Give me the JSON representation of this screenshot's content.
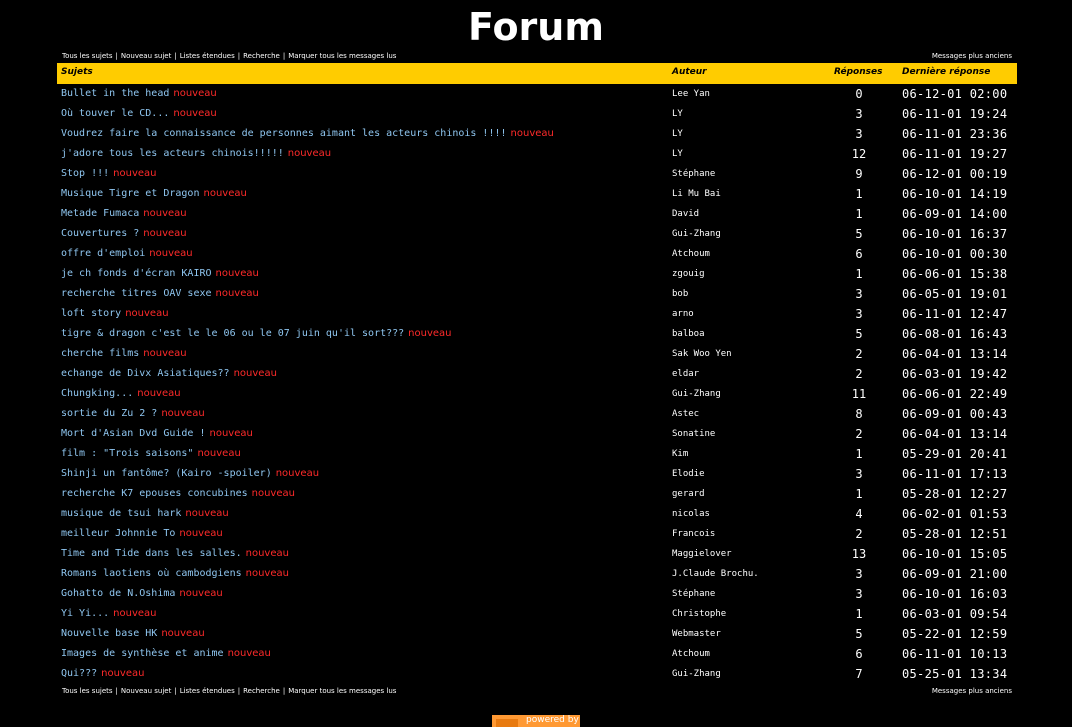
{
  "title": "Forum",
  "nav": {
    "links": [
      "Tous les sujets",
      "Nouveau sujet",
      "Listes étendues",
      "Recherche",
      "Marquer tous les messages lus"
    ],
    "older": "Messages plus anciens"
  },
  "columns": {
    "subject": "Sujets",
    "author": "Auteur",
    "replies": "Réponses",
    "last": "Dernière réponse"
  },
  "new_label": "nouveau",
  "topics": [
    {
      "subject": "Bullet in the head",
      "author": "Lee Yan",
      "replies": "0",
      "last": "06-12-01 02:00"
    },
    {
      "subject": "Où touver le CD...",
      "author": "LY",
      "replies": "3",
      "last": "06-11-01 19:24"
    },
    {
      "subject": "Voudrez faire la connaissance de personnes aimant les acteurs chinois !!!!",
      "author": "LY",
      "replies": "3",
      "last": "06-11-01 23:36"
    },
    {
      "subject": "j'adore tous les acteurs chinois!!!!!",
      "author": "LY",
      "replies": "12",
      "last": "06-11-01 19:27"
    },
    {
      "subject": "Stop !!!",
      "author": "Stéphane",
      "replies": "9",
      "last": "06-12-01 00:19"
    },
    {
      "subject": "Musique Tigre et Dragon",
      "author": "Li Mu Bai",
      "replies": "1",
      "last": "06-10-01 14:19"
    },
    {
      "subject": "Metade Fumaca",
      "author": "David",
      "replies": "1",
      "last": "06-09-01 14:00"
    },
    {
      "subject": "Couvertures ?",
      "author": "Gui-Zhang",
      "replies": "5",
      "last": "06-10-01 16:37"
    },
    {
      "subject": "offre d'emploi",
      "author": "Atchoum",
      "replies": "6",
      "last": "06-10-01 00:30"
    },
    {
      "subject": "je ch fonds d'écran KAIRO",
      "author": "zgouig",
      "replies": "1",
      "last": "06-06-01 15:38"
    },
    {
      "subject": "recherche titres OAV sexe",
      "author": "bob",
      "replies": "3",
      "last": "06-05-01 19:01"
    },
    {
      "subject": "loft story",
      "author": "arno",
      "replies": "3",
      "last": "06-11-01 12:47"
    },
    {
      "subject": "tigre & dragon c'est le le 06 ou le 07 juin qu'il sort???",
      "author": "balboa",
      "replies": "5",
      "last": "06-08-01 16:43"
    },
    {
      "subject": "cherche films",
      "author": "Sak Woo Yen",
      "replies": "2",
      "last": "06-04-01 13:14"
    },
    {
      "subject": "echange de Divx Asiatiques??",
      "author": "eldar",
      "replies": "2",
      "last": "06-03-01 19:42"
    },
    {
      "subject": "Chungking...",
      "author": "Gui-Zhang",
      "replies": "11",
      "last": "06-06-01 22:49"
    },
    {
      "subject": "sortie du Zu 2 ?",
      "author": "Astec",
      "replies": "8",
      "last": "06-09-01 00:43"
    },
    {
      "subject": "Mort d'Asian Dvd Guide !",
      "author": "Sonatine",
      "replies": "2",
      "last": "06-04-01 13:14"
    },
    {
      "subject": "film : \"Trois saisons\"",
      "author": "Kim",
      "replies": "1",
      "last": "05-29-01 20:41"
    },
    {
      "subject": "Shinji un fantôme? (Kairo -spoiler)",
      "author": "Elodie",
      "replies": "3",
      "last": "06-11-01 17:13"
    },
    {
      "subject": "recherche K7 epouses concubines",
      "author": "gerard",
      "replies": "1",
      "last": "05-28-01 12:27"
    },
    {
      "subject": "musique de tsui hark",
      "author": "nicolas",
      "replies": "4",
      "last": "06-02-01 01:53"
    },
    {
      "subject": "meilleur Johnnie To",
      "author": "Francois",
      "replies": "2",
      "last": "05-28-01 12:51"
    },
    {
      "subject": "Time and Tide dans les salles.",
      "author": "Maggielover",
      "replies": "13",
      "last": "06-10-01 15:05"
    },
    {
      "subject": "Romans laotiens où cambodgiens",
      "author": "J.Claude Brochu.",
      "replies": "3",
      "last": "06-09-01 21:00"
    },
    {
      "subject": "Gohatto de N.Oshima",
      "author": "Stéphane",
      "replies": "3",
      "last": "06-10-01 16:03"
    },
    {
      "subject": "Yi Yi...",
      "author": "Christophe",
      "replies": "1",
      "last": "06-03-01 09:54"
    },
    {
      "subject": "Nouvelle base HK",
      "author": "Webmaster",
      "replies": "5",
      "last": "05-22-01 12:59"
    },
    {
      "subject": "Images de synthèse et anime",
      "author": "Atchoum",
      "replies": "6",
      "last": "06-11-01 10:13"
    },
    {
      "subject": "Qui???",
      "author": "Gui-Zhang",
      "replies": "7",
      "last": "05-25-01 13:34"
    }
  ],
  "footer": {
    "powered": "powered by"
  },
  "colors": {
    "header_bg": "#ffcc00",
    "link": "#8fc6f0",
    "new": "#ff2a2a",
    "background": "#000000"
  }
}
